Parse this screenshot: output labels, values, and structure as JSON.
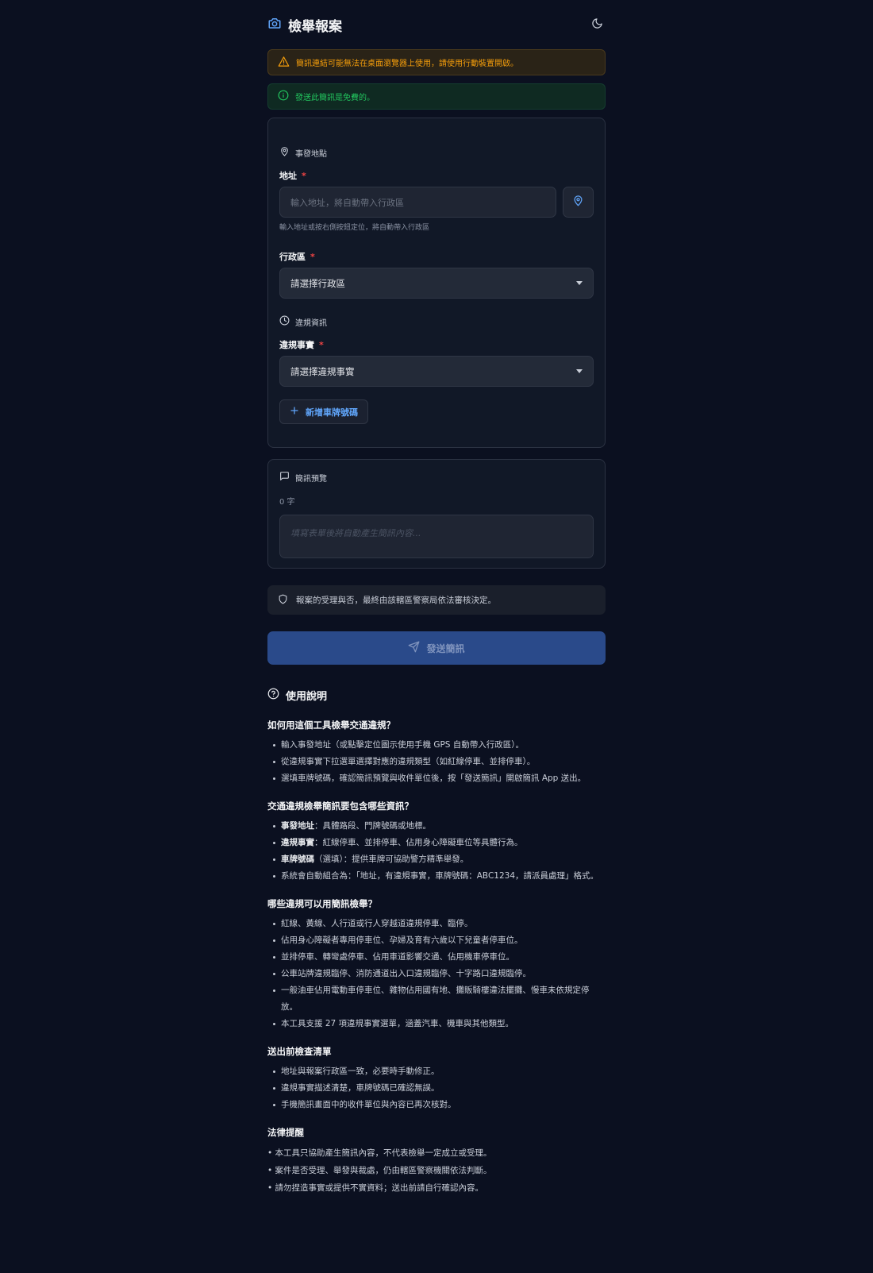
{
  "header": {
    "title": "檢舉報案",
    "camera_icon": "camera-icon",
    "theme_icon": "moon-icon"
  },
  "alerts": {
    "warning": "簡訊連結可能無法在桌面瀏覽器上使用，請使用行動裝置開啟。",
    "info": "發送此簡訊是免費的。"
  },
  "form": {
    "location_section": "事發地點",
    "address_label": "地址",
    "address_placeholder": "輸入地址，將自動帶入行政區",
    "address_hint": "輸入地址或按右側按鈕定位，將自動帶入行政區",
    "district_label": "行政區",
    "district_value": "請選擇行政區",
    "violation_section": "違規資訊",
    "violation_label": "違規事實",
    "violation_value": "請選擇違規事實",
    "add_plate_label": "新增車牌號碼",
    "required_mark": "*"
  },
  "preview": {
    "section": "簡訊預覽",
    "count": "0 字",
    "placeholder": "填寫表單後將自動產生簡訊內容..."
  },
  "notice": "報案的受理與否，最終由該轄區警察局依法審核決定。",
  "submit_label": "發送簡訊",
  "help": {
    "title": "使用說明",
    "q1": {
      "title": "如何用這個工具檢舉交通違規？",
      "items": [
        "輸入事發地址（或點擊定位圖示使用手機 GPS 自動帶入行政區）。",
        "從違規事實下拉選單選擇對應的違規類型（如紅線停車、並排停車）。",
        "選填車牌號碼，確認簡訊預覽與收件單位後，按「發送簡訊」開啟簡訊 App 送出。"
      ]
    },
    "q2": {
      "title": "交通違規檢舉簡訊要包含哪些資訊？",
      "items": [
        {
          "bold": "事發地址",
          "text": "：具體路段、門牌號碼或地標。"
        },
        {
          "bold": "違規事實",
          "text": "：紅線停車、並排停車、佔用身心障礙車位等具體行為。"
        },
        {
          "bold": "車牌號碼",
          "text": "（選填）：提供車牌可協助警方精準舉發。"
        },
        {
          "bold": "",
          "text": "系統會自動組合為：「地址，有違規事實，車牌號碼：ABC1234，請派員處理」格式。"
        }
      ]
    },
    "q3": {
      "title": "哪些違規可以用簡訊檢舉？",
      "items": [
        "紅線、黃線、人行道或行人穿越道違規停車、臨停。",
        "佔用身心障礙者專用停車位、孕婦及育有六歲以下兒童者停車位。",
        "並排停車、轉彎處停車、佔用車道影響交通、佔用機車停車位。",
        "公車站牌違規臨停、消防通道出入口違規臨停、十字路口違規臨停。",
        "一般油車佔用電動車停車位、雜物佔用國有地、攤販騎樓違法擺攤、慢車未依規定停放。",
        "本工具支援 27 項違規事實選單，涵蓋汽車、機車與其他類型。"
      ]
    },
    "q4": {
      "title": "送出前檢查清單",
      "items": [
        "地址與報案行政區一致，必要時手動修正。",
        "違規事實描述清楚，車牌號碼已確認無誤。",
        "手機簡訊畫面中的收件單位與內容已再次核對。"
      ]
    },
    "q5": {
      "title": "法律提醒",
      "items": [
        "• 本工具只協助產生簡訊內容，不代表檢舉一定成立或受理。",
        "• 案件是否受理、舉發與裁處，仍由轄區警察機關依法判斷。",
        "• 請勿捏造事實或提供不實資料；送出前請自行確認內容。"
      ]
    }
  }
}
